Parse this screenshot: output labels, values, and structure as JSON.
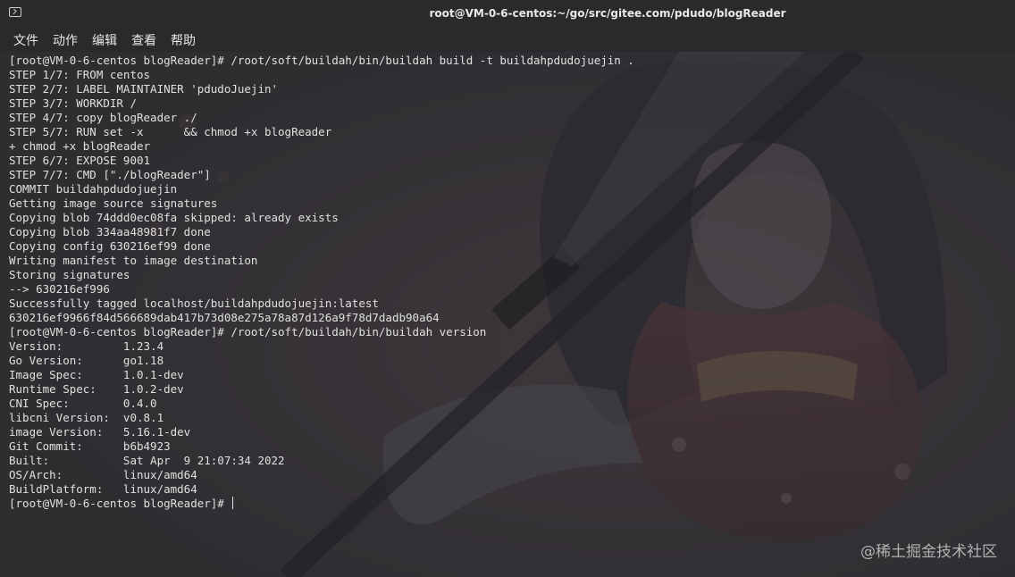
{
  "window": {
    "title": "root@VM-0-6-centos:~/go/src/gitee.com/pdudo/blogReader"
  },
  "menu": {
    "items": [
      {
        "label": "文件"
      },
      {
        "label": "动作"
      },
      {
        "label": "编辑"
      },
      {
        "label": "查看"
      },
      {
        "label": "帮助"
      }
    ]
  },
  "terminal": {
    "lines": [
      "[root@VM-0-6-centos blogReader]# /root/soft/buildah/bin/buildah build -t buildahpdudojuejin .",
      "STEP 1/7: FROM centos",
      "STEP 2/7: LABEL MAINTAINER 'pdudoJuejin'",
      "STEP 3/7: WORKDIR /",
      "STEP 4/7: copy blogReader ./",
      "STEP 5/7: RUN set -x      && chmod +x blogReader",
      "+ chmod +x blogReader",
      "STEP 6/7: EXPOSE 9001",
      "STEP 7/7: CMD [\"./blogReader\"]",
      "COMMIT buildahpdudojuejin",
      "Getting image source signatures",
      "Copying blob 74ddd0ec08fa skipped: already exists",
      "Copying blob 334aa48981f7 done",
      "Copying config 630216ef99 done",
      "Writing manifest to image destination",
      "Storing signatures",
      "--> 630216ef996",
      "Successfully tagged localhost/buildahpdudojuejin:latest",
      "630216ef9966f84d566689dab417b73d08e275a78a87d126a9f78d7dadb90a64",
      "[root@VM-0-6-centos blogReader]# /root/soft/buildah/bin/buildah version",
      "Version:         1.23.4",
      "Go Version:      go1.18",
      "Image Spec:      1.0.1-dev",
      "Runtime Spec:    1.0.2-dev",
      "CNI Spec:        0.4.0",
      "libcni Version:  v0.8.1",
      "image Version:   5.16.1-dev",
      "Git Commit:      b6b4923",
      "Built:           Sat Apr  9 21:07:34 2022",
      "OS/Arch:         linux/amd64",
      "BuildPlatform:   linux/amd64"
    ],
    "prompt": "[root@VM-0-6-centos blogReader]# "
  },
  "watermark": {
    "text": "@稀土掘金技术社区"
  },
  "colors": {
    "titlebar": "#2a2a2c",
    "terminal_bg": "#35353a",
    "text": "#e0e0e0"
  }
}
